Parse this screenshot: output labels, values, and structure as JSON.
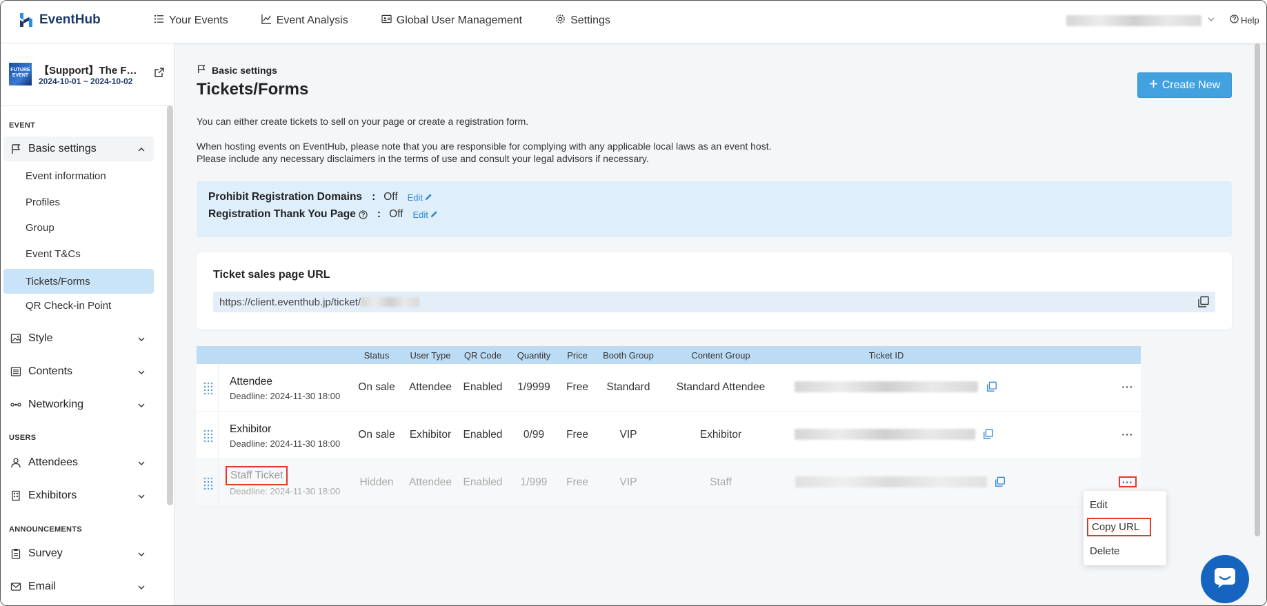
{
  "app": {
    "name": "EventHub"
  },
  "nav": {
    "items": [
      {
        "label": "Your Events",
        "icon": "list-icon"
      },
      {
        "label": "Event Analysis",
        "icon": "chart-icon"
      },
      {
        "label": "Global User Management",
        "icon": "id-card-icon"
      },
      {
        "label": "Settings",
        "icon": "gear-icon"
      }
    ],
    "help": "Help"
  },
  "event": {
    "thumb_text": "FUTURE EVENT",
    "title": "【Support】The F…",
    "dates": "2024-10-01 ~ 2024-10-02"
  },
  "sidebar": {
    "sections": {
      "event": "EVENT",
      "users": "USERS",
      "announcements": "ANNOUNCEMENTS"
    },
    "basic_settings": "Basic settings",
    "children": [
      "Event information",
      "Profiles",
      "Group",
      "Event T&Cs",
      "Tickets/Forms",
      "QR Check-in Point"
    ],
    "style": "Style",
    "contents": "Contents",
    "networking": "Networking",
    "attendees": "Attendees",
    "exhibitors": "Exhibitors",
    "survey": "Survey",
    "email": "Email"
  },
  "page": {
    "breadcrumb": "Basic settings",
    "title": "Tickets/Forms",
    "create_button": "Create New",
    "desc1": "You can either create tickets to sell on your page or create a registration form.",
    "desc2": "When hosting events on EventHub, please note that you are responsible for complying with any applicable local laws as an event host.",
    "desc3": "Please include any necessary disclaimers in the terms of use and consult your legal advisors if necessary."
  },
  "settings": {
    "prohibit_label": "Prohibit Registration Domains",
    "prohibit_value": "Off",
    "thankyou_label": "Registration Thank You Page",
    "thankyou_value": "Off",
    "colon": ":",
    "edit": "Edit"
  },
  "url_card": {
    "title": "Ticket sales page URL",
    "url": "https://client.eventhub.jp/ticket/"
  },
  "table": {
    "headers": [
      "Status",
      "User Type",
      "QR Code",
      "Quantity",
      "Price",
      "Booth Group",
      "Content Group",
      "Ticket ID"
    ],
    "rows": [
      {
        "name": "Attendee",
        "deadline": "Deadline: 2024-11-30 18:00",
        "status": "On sale",
        "user_type": "Attendee",
        "qr": "Enabled",
        "quantity": "1/9999",
        "price": "Free",
        "booth": "Standard",
        "content": "Standard Attendee"
      },
      {
        "name": "Exhibitor",
        "deadline": "Deadline: 2024-11-30 18:00",
        "status": "On sale",
        "user_type": "Exhibitor",
        "qr": "Enabled",
        "quantity": "0/99",
        "price": "Free",
        "booth": "VIP",
        "content": "Exhibitor"
      },
      {
        "name": "Staff Ticket",
        "deadline": "Deadline: 2024-11-30 18:00",
        "status": "Hidden",
        "user_type": "Attendee",
        "qr": "Enabled",
        "quantity": "1/999",
        "price": "Free",
        "booth": "VIP",
        "content": "Staff"
      }
    ],
    "more": "···"
  },
  "dropdown": {
    "items": [
      "Edit",
      "Copy URL",
      "Delete"
    ]
  },
  "colors": {
    "accent": "#42a2e0",
    "active_bg": "#c9e3f9",
    "highlight": "#e0382b",
    "brand": "#1c3b6b"
  }
}
